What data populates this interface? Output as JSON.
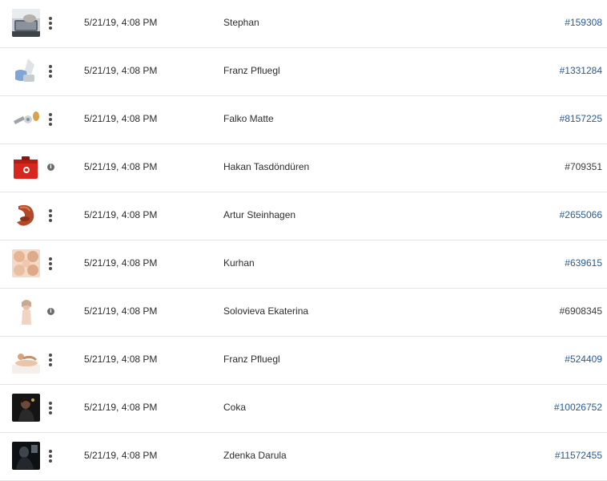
{
  "rows": [
    {
      "date": "5/21/19, 4:08 PM",
      "name": "Stephan",
      "id": "#159308",
      "action": "more-menu",
      "id_link": true,
      "thumb": "laptop-typing"
    },
    {
      "date": "5/21/19, 4:08 PM",
      "name": "Franz Pfluegl",
      "id": "#1331284",
      "action": "more-menu",
      "id_link": true,
      "thumb": "hand-spray"
    },
    {
      "date": "5/21/19, 4:08 PM",
      "name": "Falko Matte",
      "id": "#8157225",
      "action": "more-menu",
      "id_link": true,
      "thumb": "tools"
    },
    {
      "date": "5/21/19, 4:08 PM",
      "name": "Hakan Tasdöndüren",
      "id": "#709351",
      "action": "info",
      "id_link": false,
      "thumb": "red-case"
    },
    {
      "date": "5/21/19, 4:08 PM",
      "name": "Artur Steinhagen",
      "id": "#2655066",
      "action": "more-menu",
      "id_link": true,
      "thumb": "dish"
    },
    {
      "date": "5/21/19, 4:08 PM",
      "name": "Kurhan",
      "id": "#639615",
      "action": "more-menu",
      "id_link": true,
      "thumb": "faces"
    },
    {
      "date": "5/21/19, 4:08 PM",
      "name": "Solovieva Ekaterina",
      "id": "#6908345",
      "action": "info",
      "id_link": false,
      "thumb": "woman-portrait"
    },
    {
      "date": "5/21/19, 4:08 PM",
      "name": "Franz Pfluegl",
      "id": "#524409",
      "action": "more-menu",
      "id_link": true,
      "thumb": "spa"
    },
    {
      "date": "5/21/19, 4:08 PM",
      "name": "Coka",
      "id": "#10026752",
      "action": "more-menu",
      "id_link": true,
      "thumb": "dark-portrait"
    },
    {
      "date": "5/21/19, 4:08 PM",
      "name": "Zdenka Darula",
      "id": "#11572455",
      "action": "more-menu",
      "id_link": true,
      "thumb": "dark-silhouette"
    }
  ],
  "colors": {
    "link": "#2a5a93",
    "text": "#2c2c2c",
    "divider": "#e3e3e3",
    "info_icon": "#6b6b6b"
  }
}
